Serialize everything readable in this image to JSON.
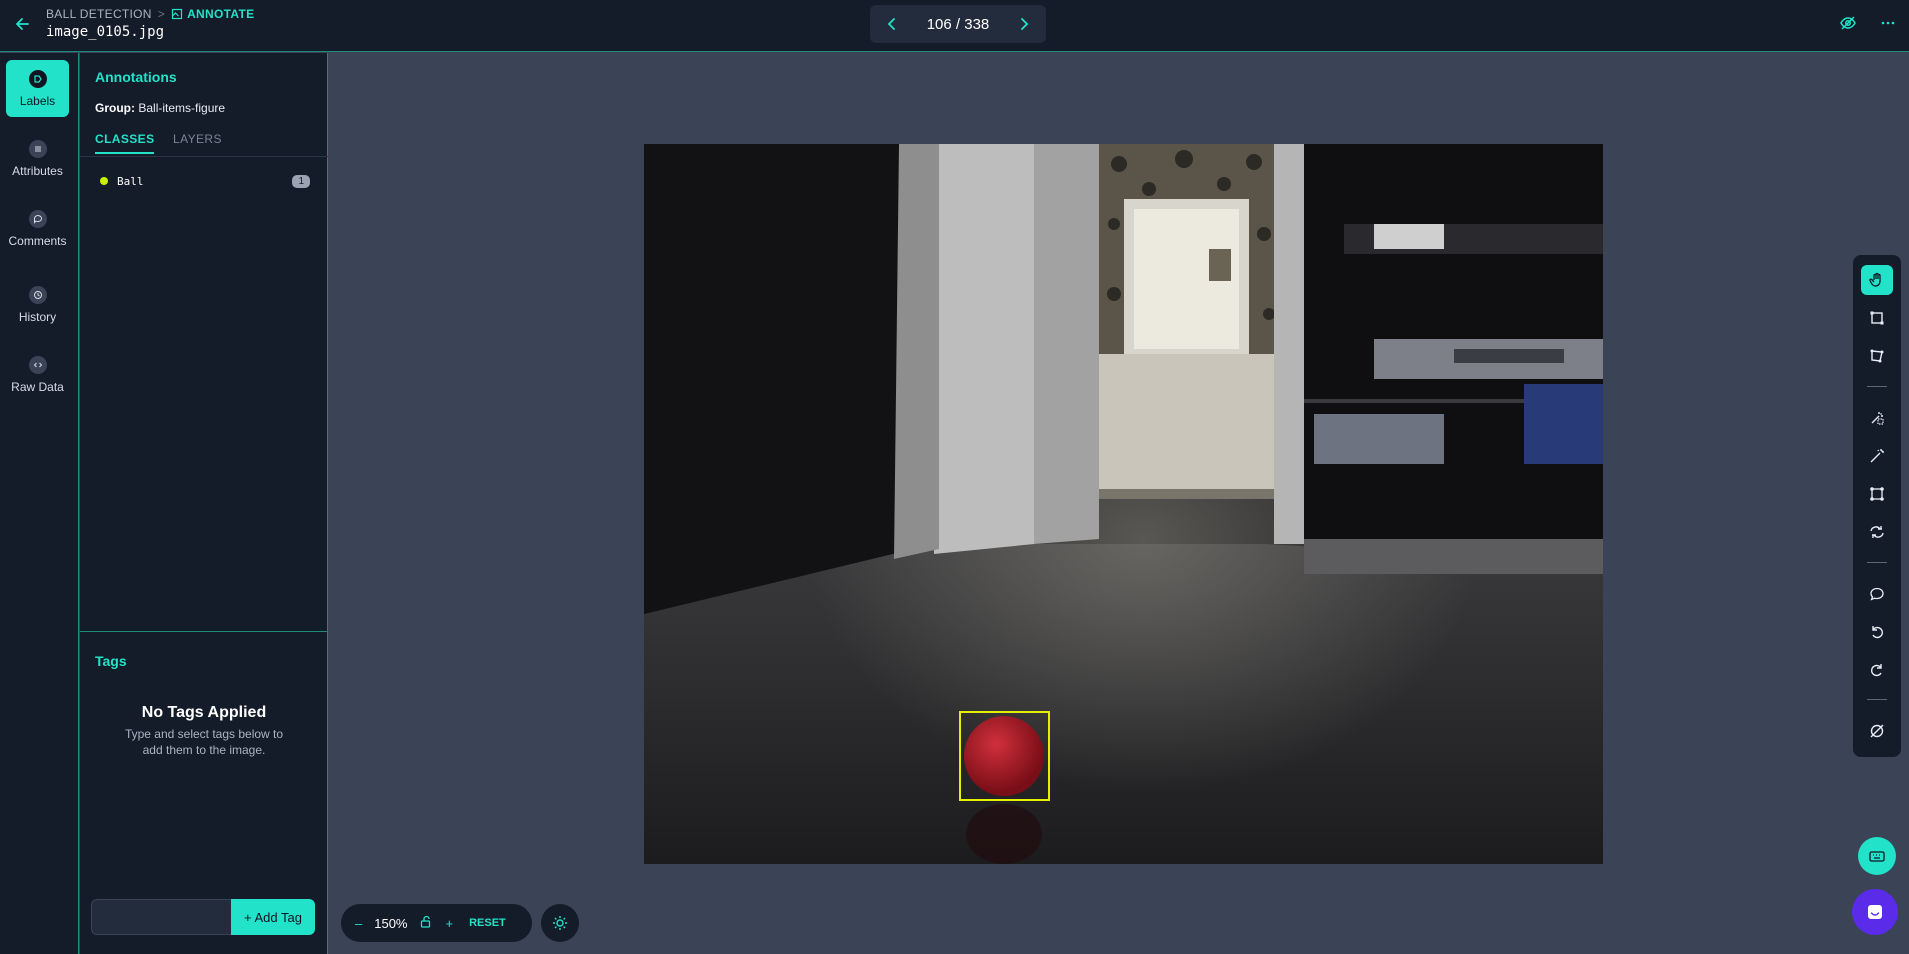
{
  "header": {
    "breadcrumb_project": "BALL DETECTION",
    "breadcrumb_separator": ">",
    "breadcrumb_current": "ANNOTATE",
    "filename": "image_0105.jpg",
    "pager": "106 / 338"
  },
  "rail": {
    "items": [
      {
        "label": "Labels",
        "icon": "label-icon"
      },
      {
        "label": "Attributes",
        "icon": "list-icon"
      },
      {
        "label": "Comments",
        "icon": "comment-icon"
      },
      {
        "label": "History",
        "icon": "history-icon"
      },
      {
        "label": "Raw Data",
        "icon": "code-icon"
      }
    ]
  },
  "panel": {
    "title": "Annotations",
    "group_label": "Group:",
    "group_value": "Ball-items-figure",
    "tabs": [
      "CLASSES",
      "LAYERS"
    ],
    "classes": [
      {
        "name": "Ball",
        "count": "1",
        "color": "#c8f000"
      }
    ],
    "tags_title": "Tags",
    "no_tags_title": "No Tags Applied",
    "no_tags_sub": "Type and select tags below to add them to the image.",
    "add_tag": "+ Add Tag"
  },
  "zoom": {
    "minus": "–",
    "value": "150%",
    "plus": "+",
    "reset": "RESET"
  },
  "colors": {
    "accent": "#22e3c9",
    "bbox": "#e5f000"
  }
}
